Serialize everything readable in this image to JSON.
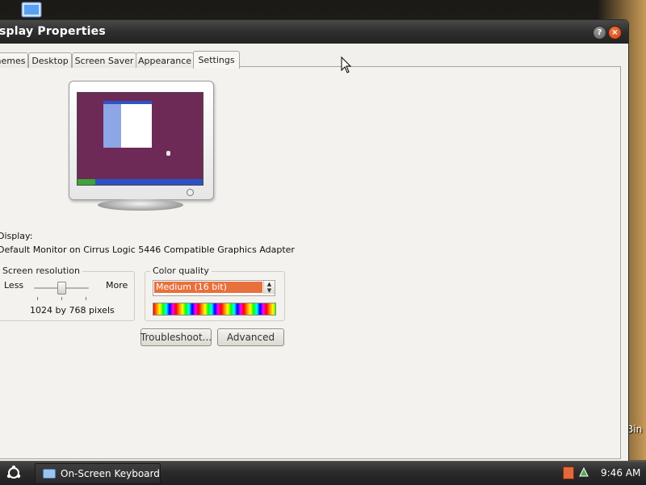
{
  "window": {
    "title": "splay Properties",
    "help_label": "?",
    "close_label": "×"
  },
  "tabs": [
    {
      "label": "hemes"
    },
    {
      "label": "Desktop"
    },
    {
      "label": "Screen Saver"
    },
    {
      "label": "Appearance"
    },
    {
      "label": "Settings",
      "active": true
    }
  ],
  "display": {
    "label": "Display:",
    "value": "Default Monitor on Cirrus Logic 5446 Compatible Graphics Adapter"
  },
  "resolution": {
    "group_label": "Screen resolution",
    "less_label": "Less",
    "more_label": "More",
    "value_text": "1024 by 768 pixels",
    "slider_level": 0.5
  },
  "color_quality": {
    "group_label": "Color quality",
    "selected": "Medium (16 bit)"
  },
  "buttons": {
    "troubleshoot": "Troubleshoot...",
    "advanced": "Advanced"
  },
  "desktop": {
    "bin_label": "Bin"
  },
  "taskbar": {
    "task_label": "On-Screen Keyboard",
    "clock": "9:46 AM"
  },
  "colors": {
    "select_highlight": "#e8703c",
    "title_bar": "#2e2e2e",
    "close_button": "#c9431a"
  },
  "icons": [
    "display-properties-icon",
    "help-icon",
    "close-icon",
    "ubuntu-logo-icon",
    "keyboard-icon",
    "mouse-pointer-icon"
  ]
}
